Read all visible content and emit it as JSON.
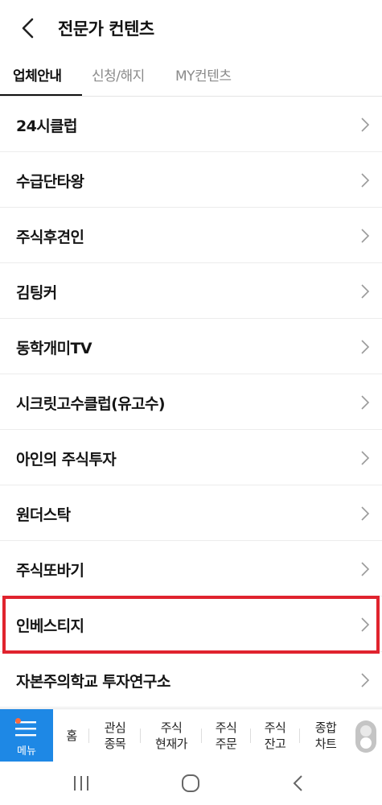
{
  "header": {
    "title": "전문가 컨텐츠",
    "back_icon": "chevron-left-icon"
  },
  "tabs": [
    {
      "label": "업체안내",
      "active": true
    },
    {
      "label": "신청/해지",
      "active": false
    },
    {
      "label": "MY컨텐츠",
      "active": false
    }
  ],
  "list": {
    "items": [
      {
        "label": "24시클럽"
      },
      {
        "label": "수급단타왕"
      },
      {
        "label": "주식후견인"
      },
      {
        "label": "김팅커"
      },
      {
        "label": "동학개미TV"
      },
      {
        "label": "시크릿고수클럽(유고수)"
      },
      {
        "label": "아인의 주식투자"
      },
      {
        "label": "원더스탁"
      },
      {
        "label": "주식또바기"
      },
      {
        "label": "인베스티지",
        "highlighted": true
      },
      {
        "label": "자본주의학교 투자연구소"
      }
    ],
    "item_icon": "chevron-right-icon",
    "highlight_color": "#e0232e"
  },
  "bottom_nav": {
    "menu_label": "메뉴",
    "menu_icon": "hamburger-menu-icon",
    "menu_color": "#1e88e5",
    "items": [
      {
        "label": "홈"
      },
      {
        "label": "관심\n종목"
      },
      {
        "label": "주식\n현재가"
      },
      {
        "label": "주식\n주문"
      },
      {
        "label": "주식\n잔고"
      },
      {
        "label": "종합\n차트"
      }
    ],
    "toggle_icon": "toggle-switch-icon"
  },
  "system_nav": {
    "recent_icon": "recent-apps-icon",
    "home_icon": "home-circle-icon",
    "back_icon": "system-back-icon"
  }
}
